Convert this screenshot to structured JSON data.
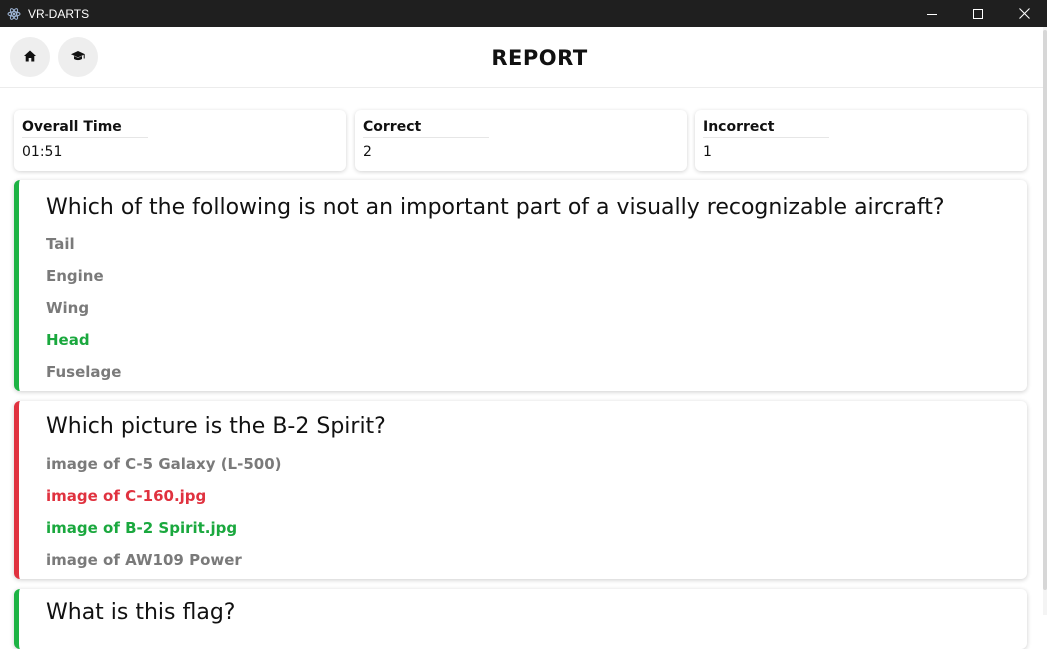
{
  "window": {
    "title": "VR-DARTS",
    "app_icon": "electron-atom-icon",
    "controls": [
      "minimize-icon",
      "maximize-icon",
      "close-icon"
    ]
  },
  "header": {
    "title": "REPORT",
    "buttons": [
      "home-icon",
      "graduation-cap-icon"
    ]
  },
  "stats": {
    "overall_time_label": "Overall Time",
    "overall_time_value": "01:51",
    "correct_label": "Correct",
    "correct_value": "2",
    "incorrect_label": "Incorrect",
    "incorrect_value": "1"
  },
  "colors": {
    "correct": "#1db344",
    "incorrect": "#e0323f",
    "neutral_option": "#7a7a7a"
  },
  "questions": [
    {
      "text": "Which of the following is not an important part of a visually recognizable aircraft?",
      "result": "correct",
      "options": [
        {
          "text": "Tail",
          "state": "neutral"
        },
        {
          "text": "Engine",
          "state": "neutral"
        },
        {
          "text": "Wing",
          "state": "neutral"
        },
        {
          "text": "Head",
          "state": "correct"
        },
        {
          "text": "Fuselage",
          "state": "neutral"
        }
      ]
    },
    {
      "text": "Which picture is the B-2 Spirit?",
      "result": "incorrect",
      "options": [
        {
          "text": "image of C-5 Galaxy (L-500)",
          "state": "neutral"
        },
        {
          "text": "image of C-160.jpg",
          "state": "selected-wrong"
        },
        {
          "text": "image of B-2 Spirit.jpg",
          "state": "correct"
        },
        {
          "text": "image of AW109 Power",
          "state": "neutral"
        }
      ]
    },
    {
      "text": "What is this flag?",
      "result": "correct",
      "options": []
    }
  ]
}
